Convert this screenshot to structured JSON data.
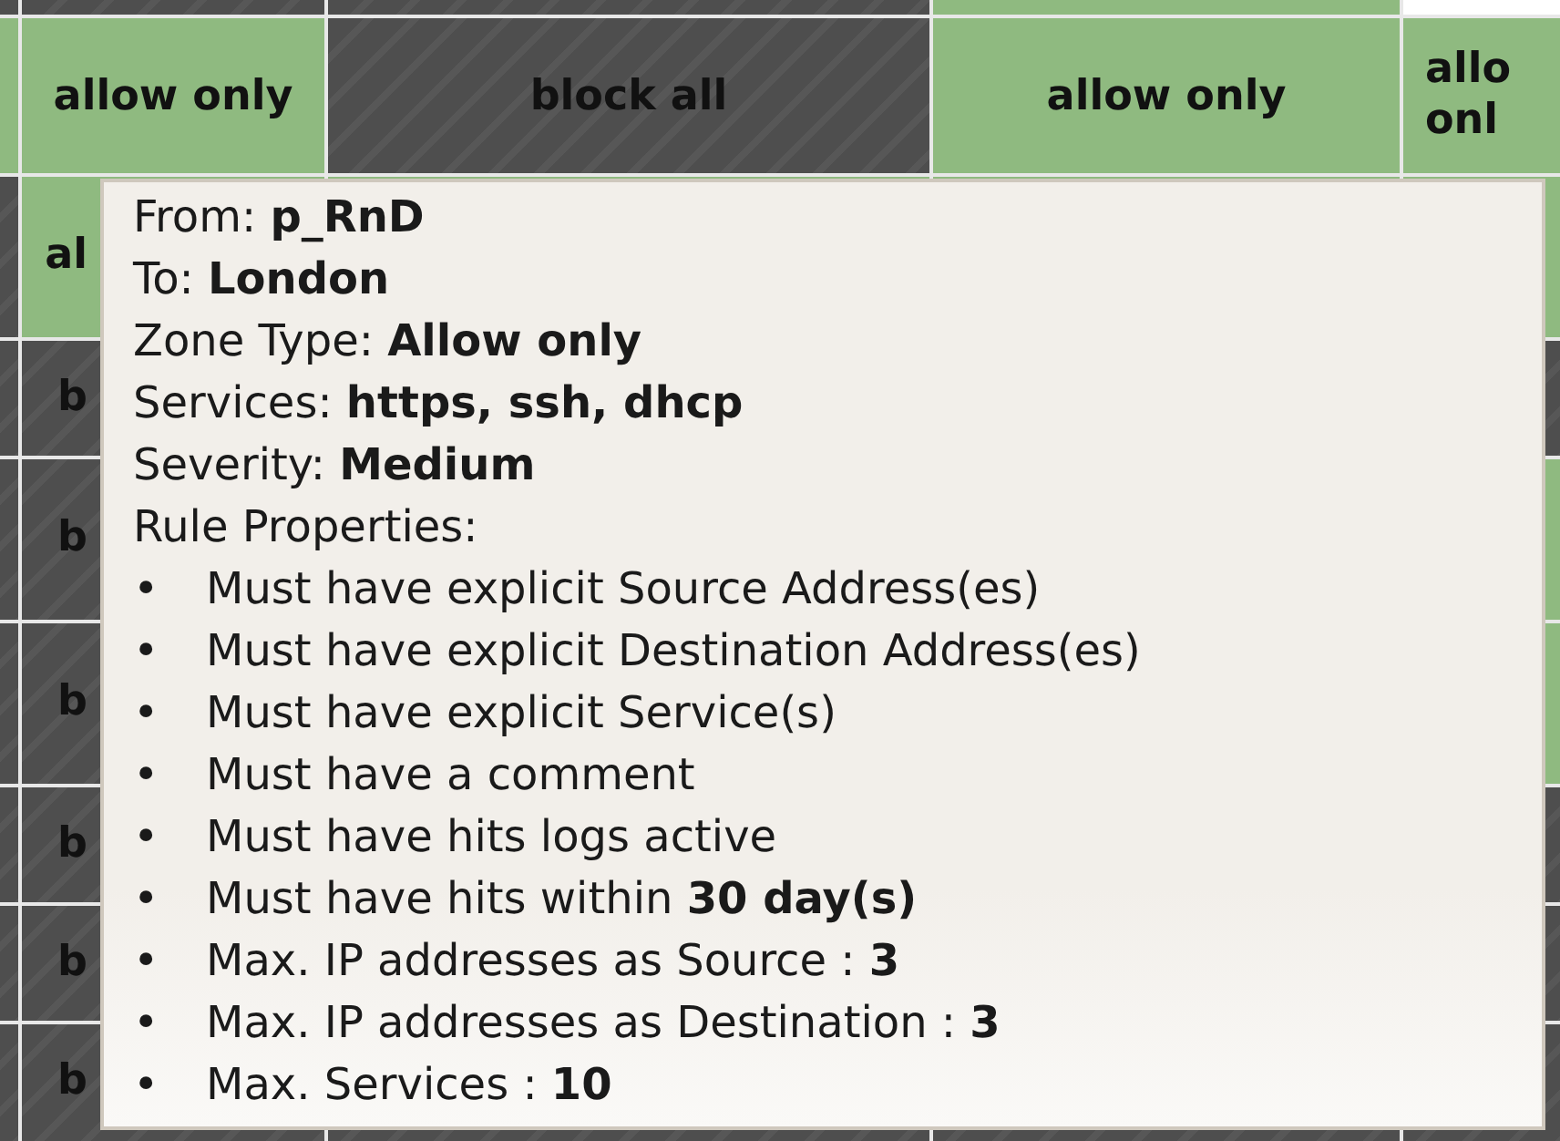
{
  "grid": {
    "rows": [
      {
        "cells": [
          {
            "kind": "block"
          },
          {
            "kind": "block"
          },
          {
            "kind": "block"
          },
          {
            "kind": "allow"
          },
          {
            "kind": "empty"
          }
        ]
      },
      {
        "cells": [
          {
            "kind": "allow"
          },
          {
            "kind": "allow",
            "text": "allow only"
          },
          {
            "kind": "block",
            "text": "block all"
          },
          {
            "kind": "allow",
            "text": "allow only"
          },
          {
            "kind": "allow",
            "text": "allo onl"
          }
        ]
      },
      {
        "cells": [
          {
            "kind": "block"
          },
          {
            "kind": "allow",
            "text": "al"
          },
          {
            "kind": "allow"
          },
          {
            "kind": "allow"
          },
          {
            "kind": "allow"
          }
        ]
      },
      {
        "cells": [
          {
            "kind": "block"
          },
          {
            "kind": "block",
            "text": "b"
          },
          {
            "kind": "block"
          }
        ]
      },
      {
        "cells": [
          {
            "kind": "block"
          },
          {
            "kind": "block",
            "text": "b"
          },
          {
            "kind": "allow"
          }
        ]
      },
      {
        "cells": [
          {
            "kind": "block"
          },
          {
            "kind": "block",
            "text": "b"
          },
          {
            "kind": "allow"
          }
        ]
      },
      {
        "cells": [
          {
            "kind": "block"
          },
          {
            "kind": "block",
            "text": "b"
          },
          {
            "kind": "block"
          }
        ]
      },
      {
        "cells": [
          {
            "kind": "block"
          },
          {
            "kind": "block",
            "text": "b"
          },
          {
            "kind": "block"
          }
        ]
      },
      {
        "cells": [
          {
            "kind": "block"
          },
          {
            "kind": "block",
            "text": "b"
          },
          {
            "kind": "block"
          },
          {
            "kind": "block"
          },
          {
            "kind": "block"
          }
        ]
      }
    ]
  },
  "tooltip": {
    "lines": [
      "From: **p_RnD**",
      "To: **London**",
      "Zone Type: **Allow only**",
      "Services: **https, ssh, dhcp**",
      "Severity: **Medium**",
      "Rule Properties:"
    ],
    "items": [
      {
        "marker": "•",
        "text": "Must have explicit Source Address(es)"
      },
      {
        "marker": "•",
        "text": "Must have explicit Destination Address(es)"
      },
      {
        "marker": "•",
        "text": "Must have explicit Service(s)"
      },
      {
        "marker": "•",
        "text": "Must have a comment"
      },
      {
        "marker": "•",
        "text": "Must have hits logs active"
      },
      {
        "marker": "•",
        "text": "Must have hits within **30 day(s)**"
      },
      {
        "marker": "•",
        "text": "Max. IP addresses as Source : **3**"
      },
      {
        "marker": "•",
        "text": "Max. IP addresses as Destination : **3**"
      },
      {
        "marker": "•",
        "text": "Max. Services : **10**"
      }
    ]
  }
}
